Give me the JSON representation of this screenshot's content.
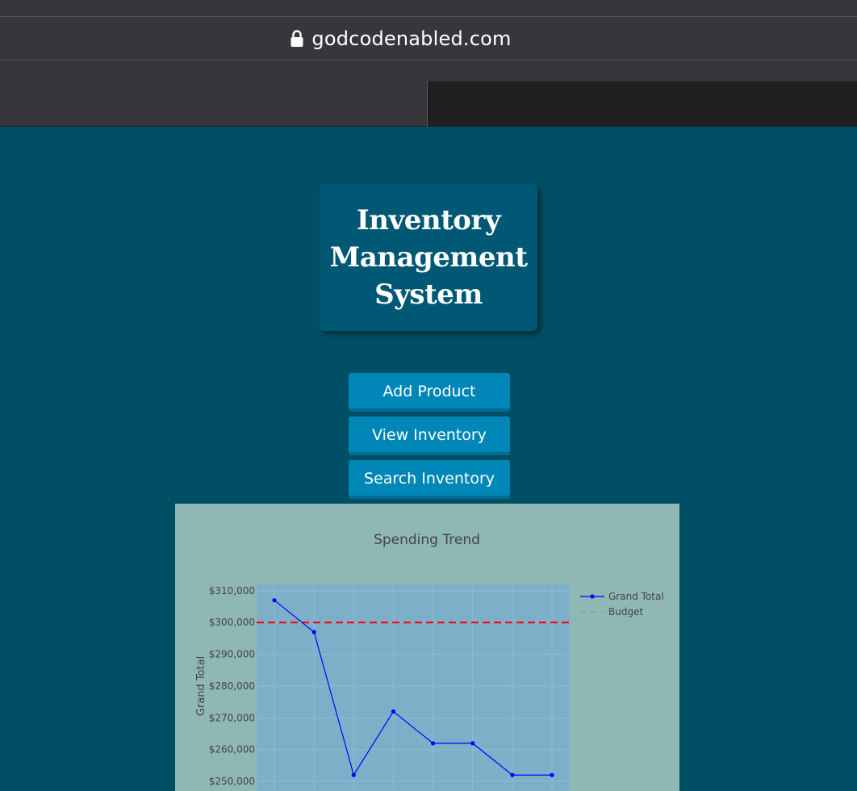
{
  "browser": {
    "url": "godcodenabled.com"
  },
  "header": {
    "title": "Inventory Management System"
  },
  "actions": {
    "add_product": "Add Product",
    "view_inventory": "View Inventory",
    "search_inventory": "Search Inventory"
  },
  "chart_data": {
    "type": "line",
    "title": "Spending Trend",
    "xlabel": "",
    "ylabel": "Grand Total",
    "ylim": [
      248500,
      312000
    ],
    "yticks": [
      250000,
      260000,
      270000,
      280000,
      290000,
      300000,
      310000
    ],
    "ytick_labels": [
      "$250,000",
      "$260,000",
      "$270,000",
      "$280,000",
      "$290,000",
      "$300,000",
      "$310,000"
    ],
    "grid": true,
    "legend_position": "top-right",
    "series": [
      {
        "name": "Grand Total",
        "color": "#0000ff",
        "style": "solid-markers",
        "values": [
          307000,
          297000,
          252000,
          272000,
          262000,
          262000,
          252000,
          252000
        ]
      },
      {
        "name": "Budget",
        "color": "#ff0000",
        "style": "dashed",
        "values": [
          300000,
          300000,
          300000,
          300000,
          300000,
          300000,
          300000,
          300000
        ]
      }
    ],
    "colors": {
      "panel_background": "#8fb7b4",
      "plot_background": "#7db0c8",
      "page_background": "#004f65",
      "button": "#0087b8"
    }
  }
}
